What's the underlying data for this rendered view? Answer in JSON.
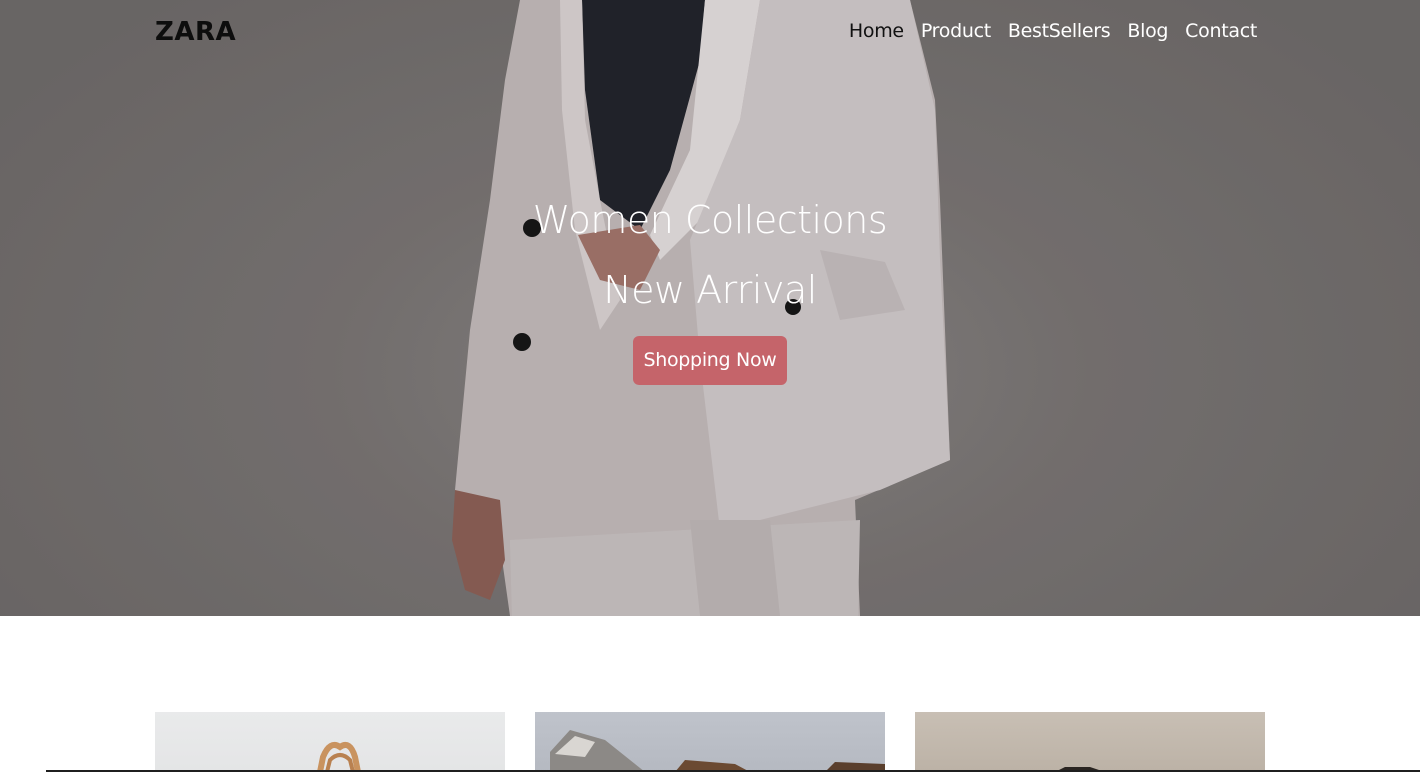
{
  "brand": {
    "name": "ZARA"
  },
  "nav": {
    "items": [
      {
        "label": "Home",
        "active": true
      },
      {
        "label": "Product",
        "active": false
      },
      {
        "label": "BestSellers",
        "active": false
      },
      {
        "label": "Blog",
        "active": false
      },
      {
        "label": "Contact",
        "active": false
      }
    ]
  },
  "hero": {
    "title": "Women Collections",
    "subtitle": "New Arrival",
    "cta_label": "Shopping Now"
  },
  "products": {
    "cards": [
      {
        "image": "handbag-photo"
      },
      {
        "image": "shoe-photo"
      },
      {
        "image": "accessory-photo"
      }
    ]
  },
  "colors": {
    "accent": "#c5646a",
    "hero_background": "#7a7574",
    "brand_text": "#0d0d0d",
    "nav_text": "#ffffff"
  }
}
